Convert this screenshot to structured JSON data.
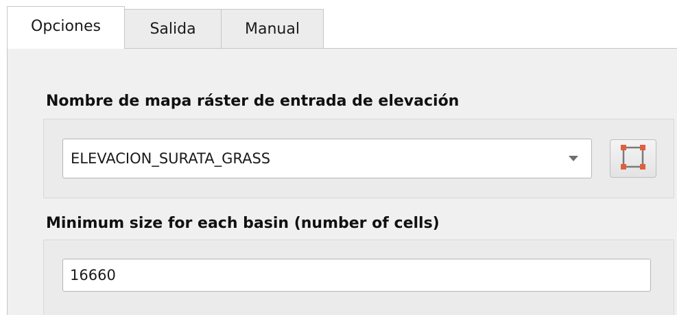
{
  "tabs": [
    {
      "label": "Opciones",
      "active": true
    },
    {
      "label": "Salida",
      "active": false
    },
    {
      "label": "Manual",
      "active": false
    }
  ],
  "params": {
    "elevation": {
      "label": "Nombre de mapa ráster de entrada de elevación",
      "value": "ELEVACION_SURATA_GRASS",
      "dropdown_icon": "chevron-down-icon",
      "extent_icon": "select-extent-icon"
    },
    "basin_size": {
      "label": "Minimum size for each basin (number of cells)",
      "value": "16660"
    }
  },
  "colors": {
    "extent_icon_corners": "#e0603c",
    "extent_icon_frame": "#7a7a7a"
  }
}
